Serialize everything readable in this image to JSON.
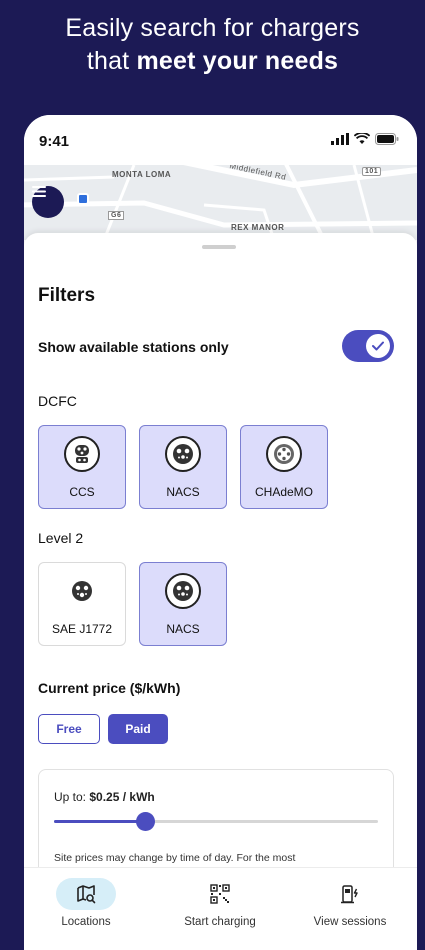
{
  "promo": {
    "line1": "Easily search for chargers",
    "line2_prefix": "that ",
    "line2_bold": "meet your needs"
  },
  "status_bar": {
    "time": "9:41"
  },
  "map": {
    "labels": {
      "area1": "MONTA LOMA",
      "road1": "Middlefield Rd",
      "area2": "REX MANOR",
      "route1": "101",
      "route2": "G6"
    }
  },
  "filters": {
    "title": "Filters",
    "available_only_label": "Show available stations only",
    "available_only_on": true,
    "dcfc": {
      "heading": "DCFC",
      "options": [
        {
          "label": "CCS",
          "selected": true,
          "icon": "ccs-plug-icon"
        },
        {
          "label": "NACS",
          "selected": true,
          "icon": "nacs-plug-icon"
        },
        {
          "label": "CHAdeMO",
          "selected": true,
          "icon": "chademo-plug-icon"
        }
      ]
    },
    "level2": {
      "heading": "Level 2",
      "options": [
        {
          "label": "SAE J1772",
          "selected": false,
          "icon": "j1772-plug-icon"
        },
        {
          "label": "NACS",
          "selected": true,
          "icon": "nacs-plug-icon"
        }
      ]
    },
    "price": {
      "title": "Current price ($/kWh)",
      "free_label": "Free",
      "paid_label": "Paid",
      "selected": "Paid",
      "upto_prefix": "Up to: ",
      "upto_value": "$0.25 / kWh",
      "slider_fraction": 0.28,
      "note": "Site prices may change by time of day. For the most"
    }
  },
  "nav": {
    "items": [
      {
        "label": "Locations",
        "icon": "map-search-icon",
        "active": true
      },
      {
        "label": "Start charging",
        "icon": "qr-code-icon",
        "active": false
      },
      {
        "label": "View sessions",
        "icon": "charging-station-icon",
        "active": false
      }
    ]
  },
  "colors": {
    "brand_dark": "#1c1a55",
    "accent": "#4b4dbf",
    "chip_selected": "#dcdcfb",
    "nav_active": "#d6eef8"
  }
}
